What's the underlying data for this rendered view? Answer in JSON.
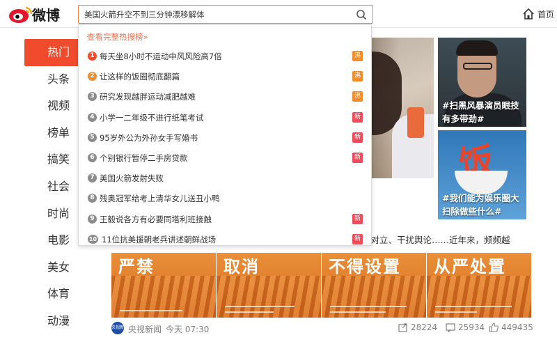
{
  "header": {
    "brand": "微博",
    "search_value": "美国火箭升空不到三分钟漂移解体",
    "home_label": "首页"
  },
  "sidebar": {
    "items": [
      {
        "label": "热门",
        "active": true
      },
      {
        "label": "头条"
      },
      {
        "label": "视频"
      },
      {
        "label": "榜单"
      },
      {
        "label": "搞笑"
      },
      {
        "label": "社会"
      },
      {
        "label": "时尚"
      },
      {
        "label": "电影"
      },
      {
        "label": "美女"
      },
      {
        "label": "体育"
      },
      {
        "label": "动漫"
      }
    ]
  },
  "dropdown": {
    "header": "查看完整热搜榜»",
    "items": [
      {
        "num": "1",
        "text": "每天坐8小时不运动中风风险高7倍",
        "badge": "沸"
      },
      {
        "num": "2",
        "text": "让这样的饭圈彻底翻篇",
        "badge": "沸"
      },
      {
        "num": "3",
        "text": "研究发现越胖运动减肥越难",
        "badge": "沸"
      },
      {
        "num": "4",
        "text": "小学一二年级不进行纸笔考试",
        "badge": "新"
      },
      {
        "num": "5",
        "text": "95岁外公为外孙女手写婚书",
        "badge": "新"
      },
      {
        "num": "6",
        "text": "个别银行暂停二手房贷款",
        "badge": "新"
      },
      {
        "num": "7",
        "text": "美国火箭发射失败",
        "badge": ""
      },
      {
        "num": "8",
        "text": "残奥冠军给考上清华女儿送丑小鸭",
        "badge": ""
      },
      {
        "num": "9",
        "text": "王毅说各方有必要同塔利班接触",
        "badge": "新"
      },
      {
        "num": "10",
        "text": "11位抗美援朝老兵讲述朝鲜战场",
        "badge": "新"
      }
    ],
    "colors": {
      "num_hot": "#f04b2d",
      "num_warm": "#f28c2d",
      "num_gray": "#8c8c8c",
      "badge_boil": "#f28c2d",
      "badge_new": "#f04b5a"
    }
  },
  "features": {
    "top_caption": "#扫黑风暴演员眼技有多带劲#",
    "bottom_caption": "#我们能为娱乐圈大扫除做些什么#",
    "bottom_word": "饭",
    "snippet": "动对立、干扰舆论……近年来，频频越"
  },
  "tiles": [
    {
      "title": "严禁"
    },
    {
      "title": "取消"
    },
    {
      "title": "不得设置"
    },
    {
      "title": "从严处置"
    }
  ],
  "post_meta": {
    "source_logo": "央视新闻",
    "source": "央视新闻",
    "time": "今天 07:30",
    "shares": "28224",
    "comments": "25934",
    "likes": "449435"
  },
  "icons": [
    "weibo-logo-icon",
    "search-icon",
    "home-icon",
    "share-icon",
    "comment-icon",
    "like-icon"
  ]
}
